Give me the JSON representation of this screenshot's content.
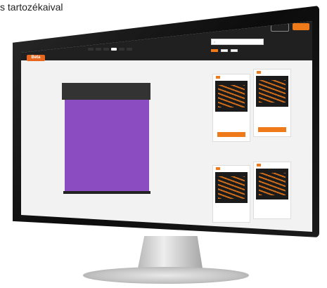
{
  "caption": "s tartozékaival",
  "header": {
    "logo": "Beta",
    "menu": [
      "",
      "",
      "",
      "",
      "",
      ""
    ],
    "login_label": "",
    "order_label": ""
  },
  "config": {
    "title": "",
    "steps": [
      "",
      "",
      "",
      "",
      "",
      "",
      ""
    ]
  },
  "sidebar": {
    "search_placeholder": "",
    "filters": [
      "",
      "",
      ""
    ]
  },
  "cards": [
    {
      "price": "",
      "button": ""
    },
    {
      "price": "",
      "button": ""
    },
    {
      "price": "",
      "button": ""
    },
    {
      "price": "",
      "button": ""
    }
  ],
  "colors": {
    "accent": "#ef7a1a",
    "panel": "#8a4cc0",
    "topbar": "#202020"
  },
  "icons": [
    "search-icon"
  ]
}
